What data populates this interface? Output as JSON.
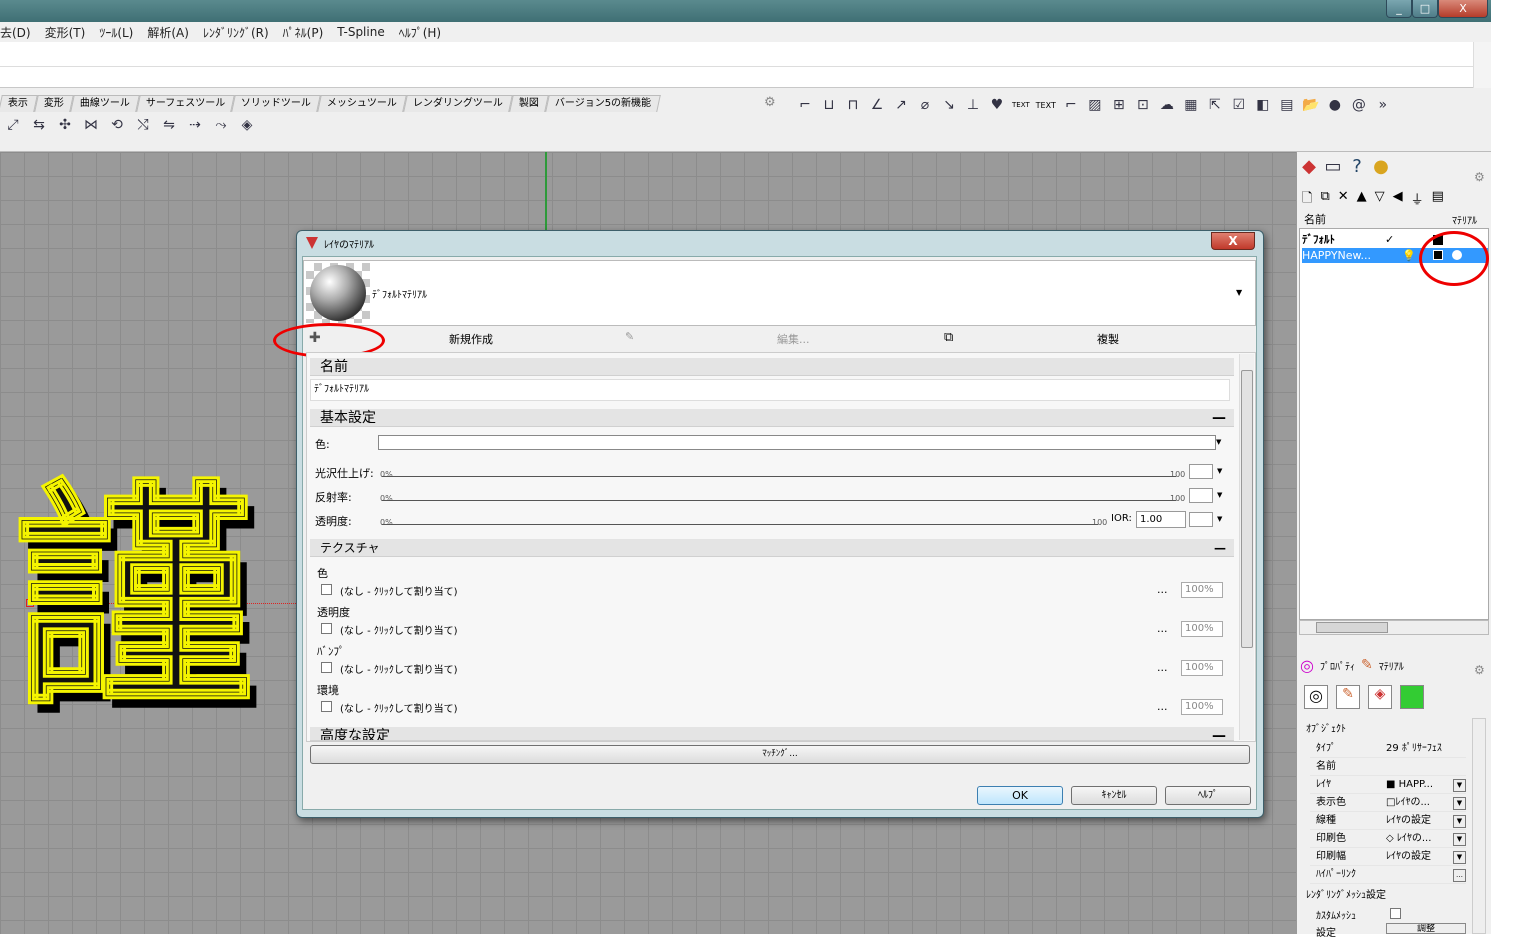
{
  "menu": [
    "去(D)",
    "変形(T)",
    "ﾂｰﾙ(L)",
    "解析(A)",
    "ﾚﾝﾀﾞﾘﾝｸﾞ(R)",
    "ﾊﾟﾈﾙ(P)",
    "T-Spline",
    "ﾍﾙﾌﾟ(H)"
  ],
  "window_buttons": [
    "_",
    "□",
    "X"
  ],
  "tabs": [
    "表示",
    "変形",
    "曲線ツール",
    "サーフェスツール",
    "ソリッドツール",
    "メッシュツール",
    "レンダリングツール",
    "製図",
    "バージョン5の新機能"
  ],
  "toolbar_text": {
    "text1": "TEXT",
    "text2": "TEXT"
  },
  "layers": {
    "header_name": "名前",
    "header_material": "ﾏﾃﾘｱﾙ",
    "rows": [
      {
        "name": "ﾃﾞﾌｫﾙﾄ",
        "check": "✓"
      },
      {
        "name": "HAPPYNew..."
      }
    ]
  },
  "viewport": {
    "kanji": "謹"
  },
  "panel_tabs": {
    "properties": "ﾌﾟﾛﾊﾟﾃｨ",
    "material": "ﾏﾃﾘｱﾙ"
  },
  "object_props": {
    "section": "ｵﾌﾞｼﾞｪｸﾄ",
    "rows": [
      {
        "k": "ﾀｲﾌﾟ",
        "v": "29 ﾎﾟﾘｻｰﾌｪｽ"
      },
      {
        "k": "名前",
        "v": ""
      },
      {
        "k": "ﾚｲﾔ",
        "v": "■ HAPP..."
      },
      {
        "k": "表示色",
        "v": "□ﾚｲﾔの..."
      },
      {
        "k": "線種",
        "v": "ﾚｲﾔの設定"
      },
      {
        "k": "印刷色",
        "v": "◇ ﾚｲﾔの..."
      },
      {
        "k": "印刷幅",
        "v": "ﾚｲﾔの設定"
      },
      {
        "k": "ﾊｲﾊﾟｰﾘﾝｸ",
        "v": ""
      }
    ],
    "mesh_section": "ﾚﾝﾀﾞﾘﾝｸﾞﾒｯｼｭ設定",
    "custom_mesh": "ｶｽﾀﾑﾒｯｼｭ",
    "settings": "設定",
    "adjust": "調整"
  },
  "dialog": {
    "title": "ﾚｲﾔのﾏﾃﾘｱﾙ",
    "close": "X",
    "material_name": "ﾃﾞﾌｫﾙﾄﾏﾃﾘｱﾙ",
    "actions": {
      "new": "新規作成",
      "edit": "編集...",
      "duplicate": "複製"
    },
    "name_section": "名前",
    "name_value": "ﾃﾞﾌｫﾙﾄﾏﾃﾘｱﾙ",
    "basic_section": "基本設定",
    "color_label": "色:",
    "gloss_label": "光沢仕上げ:",
    "reflect_label": "反射率:",
    "transp_label": "透明度:",
    "pct0": "0%",
    "max100": "100",
    "ior_label": "IOR:",
    "ior_value": "1.00",
    "texture_section": "テクスチャ",
    "tex": [
      {
        "label": "色",
        "none": "(なし - ｸﾘｯｸして割り当て)",
        "pct": "100%"
      },
      {
        "label": "透明度",
        "none": "(なし - ｸﾘｯｸして割り当て)",
        "pct": "100%"
      },
      {
        "label": "ﾊﾞﾝﾌﾟ",
        "none": "(なし - ｸﾘｯｸして割り当て)",
        "pct": "100%"
      },
      {
        "label": "環境",
        "none": "(なし - ｸﾘｯｸして割り当て)",
        "pct": "100%"
      }
    ],
    "dots": "...",
    "advanced_section": "高度な設定",
    "matching": "ﾏｯﾁﾝｸﾞ...",
    "ok": "OK",
    "cancel": "ｷｬﾝｾﾙ",
    "help": "ﾍﾙﾌﾟ"
  },
  "colors": {
    "accent_red": "#e00000",
    "selection_blue": "#3399ff",
    "titlebar": "#4a7c80"
  }
}
